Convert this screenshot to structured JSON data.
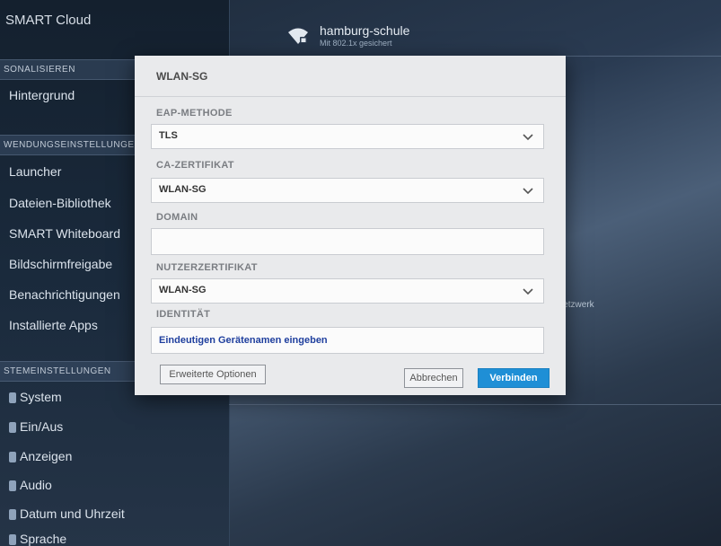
{
  "sidebar": {
    "app_title": "SMART Cloud",
    "sections": [
      {
        "label": "SONALISIEREN"
      },
      {
        "label": "WENDUNGSEINSTELLUNGEN"
      },
      {
        "label": "STEMEINSTELLUNGEN"
      }
    ],
    "items": [
      {
        "label": "Hintergrund"
      },
      {
        "label": "Launcher"
      },
      {
        "label": "Dateien-Bibliothek"
      },
      {
        "label": "SMART Whiteboard"
      },
      {
        "label": "Bildschirmfreigabe"
      },
      {
        "label": "Benachrichtigungen"
      },
      {
        "label": "Installierte Apps"
      },
      {
        "label": "System"
      },
      {
        "label": "Ein/Aus"
      },
      {
        "label": "Anzeigen"
      },
      {
        "label": "Audio"
      },
      {
        "label": "Datum und Uhrzeit"
      },
      {
        "label": "Sprache"
      }
    ]
  },
  "network_header": {
    "ssid": "hamburg-schule",
    "security": "Mit 802.1x gesichert",
    "icon": "wifi-lock-icon"
  },
  "background": {
    "netzwerk_label": "Netzwerk"
  },
  "dialog": {
    "title": "WLAN-SG",
    "eap_label": "EAP-METHODE",
    "eap_value": "TLS",
    "ca_label": "CA-ZERTIFIKAT",
    "ca_value": "WLAN-SG",
    "domain_label": "DOMAIN",
    "domain_value": "",
    "user_cert_label": "NUTZERZERTIFIKAT",
    "user_cert_value": "WLAN-SG",
    "identity_label": "IDENTITÄT",
    "identity_placeholder": "Eindeutigen Gerätenamen eingeben",
    "advanced_button": "Erweiterte Optionen",
    "cancel_button": "Abbrechen",
    "connect_button": "Verbinden"
  },
  "colors": {
    "accent": "#1f8fd6",
    "dialog_bg": "#e9eaec"
  }
}
